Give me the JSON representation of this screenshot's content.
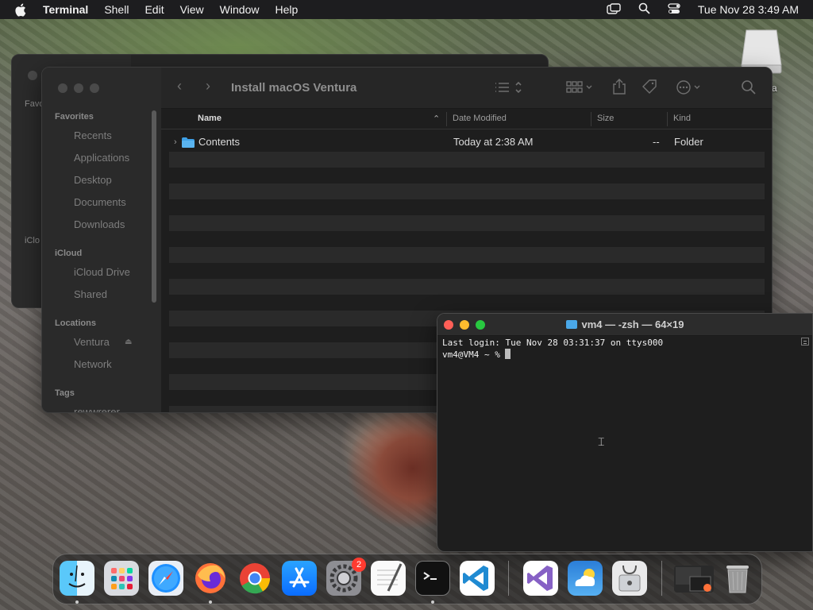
{
  "menubar": {
    "app_name": "Terminal",
    "menus": [
      "Shell",
      "Edit",
      "View",
      "Window",
      "Help"
    ],
    "clock": "Tue Nov 28  3:49 AM"
  },
  "desktop": {
    "drive_label": "a"
  },
  "back_window": {
    "labels": [
      "Favori",
      "iClo"
    ]
  },
  "finder": {
    "title": "Install macOS Ventura",
    "sidebar": {
      "favorites_header": "Favorites",
      "favorites": [
        "Recents",
        "Applications",
        "Desktop",
        "Documents",
        "Downloads"
      ],
      "icloud_header": "iCloud",
      "icloud": [
        "iCloud Drive",
        "Shared"
      ],
      "locations_header": "Locations",
      "locations": [
        "Ventura",
        "Network"
      ],
      "tags_header": "Tags",
      "tags": [
        "rewwrerer"
      ]
    },
    "columns": {
      "name": "Name",
      "date": "Date Modified",
      "size": "Size",
      "kind": "Kind"
    },
    "rows": [
      {
        "name": "Contents",
        "date": "Today at 2:38 AM",
        "size": "--",
        "kind": "Folder"
      }
    ]
  },
  "terminal": {
    "title": "vm4 — -zsh — 64×19",
    "lines": [
      "Last login: Tue Nov 28 03:31:37 on ttys000",
      "vm4@VM4 ~ % "
    ]
  },
  "dock": {
    "badge_count": "2",
    "apps": [
      "finder-icon",
      "launchpad-icon",
      "safari-icon",
      "firefox-icon",
      "chrome-icon",
      "app-store-icon",
      "system-settings-icon",
      "textedit-icon",
      "terminal-icon",
      "vscode-icon",
      "visual-studio-icon",
      "weather-icon",
      "disk-utility-icon",
      "window-thumbnail-icon",
      "trash-icon"
    ]
  }
}
